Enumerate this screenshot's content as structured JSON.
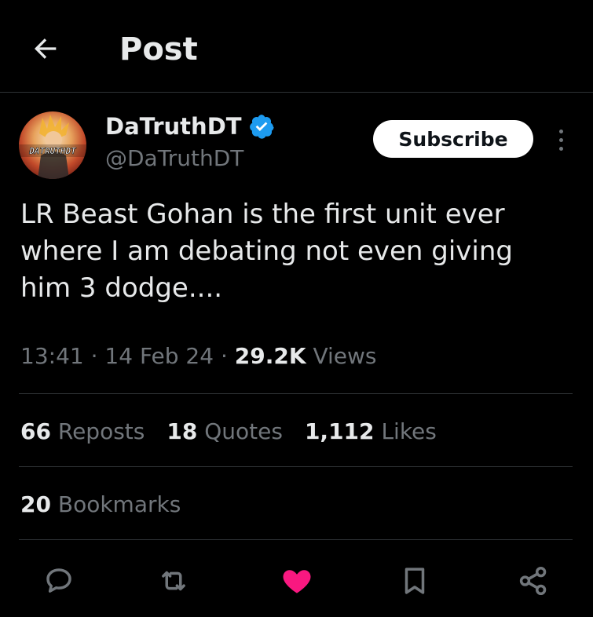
{
  "header": {
    "title": "Post",
    "back_icon": "arrow-left-icon"
  },
  "author": {
    "name": "DaTruthDT",
    "handle": "@DaTruthDT",
    "verified": true,
    "avatar_text": "DATRUTHDT",
    "verified_color": "#1d9bf0"
  },
  "subscribe_label": "Subscribe",
  "tweet": {
    "text": "LR Beast Gohan is the first unit ever where I am debating not even giving him 3 dodge....",
    "time": "13:41",
    "separator": "·",
    "date": "14 Feb 24",
    "views_count": "29.2K",
    "views_label": "Views"
  },
  "stats": {
    "reposts_count": "66",
    "reposts_label": "Reposts",
    "quotes_count": "18",
    "quotes_label": "Quotes",
    "likes_count": "1,112",
    "likes_label": "Likes",
    "bookmarks_count": "20",
    "bookmarks_label": "Bookmarks"
  },
  "actions": [
    {
      "name": "reply",
      "icon": "speech-bubble-icon"
    },
    {
      "name": "repost",
      "icon": "repost-arrows-icon"
    },
    {
      "name": "like",
      "icon": "heart-icon",
      "active": true
    },
    {
      "name": "bookmark",
      "icon": "bookmark-icon"
    },
    {
      "name": "share",
      "icon": "share-nodes-icon"
    }
  ],
  "colors": {
    "background": "#000000",
    "text_primary": "#e7e9ea",
    "text_secondary": "#71767b",
    "like_active": "#f91880",
    "divider": "#2f3336"
  }
}
